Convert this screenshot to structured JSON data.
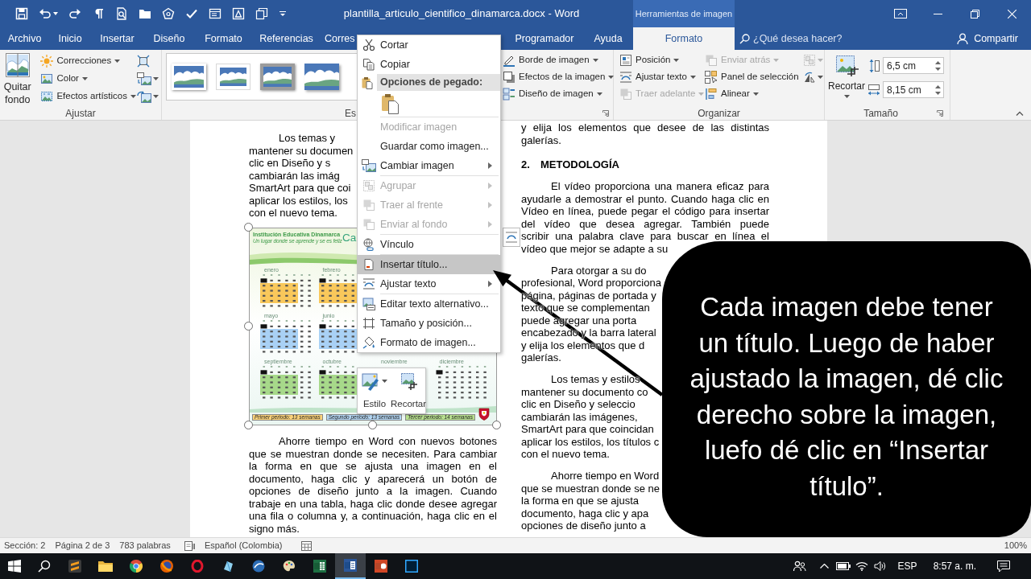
{
  "title_bar": {
    "title": "plantilla_articulo_cientifico_dinamarca.docx - Word",
    "contextual_header": "Herramientas de imagen"
  },
  "tabs": [
    {
      "label": "Archivo",
      "selected": false
    },
    {
      "label": "Inicio",
      "selected": false
    },
    {
      "label": "Insertar",
      "selected": false
    },
    {
      "label": "Diseño",
      "selected": false
    },
    {
      "label": "Formato",
      "selected": false
    },
    {
      "label": "Referencias",
      "selected": false
    },
    {
      "label": "Corres",
      "selected": false
    },
    {
      "label": "Programador",
      "selected": false
    },
    {
      "label": "Ayuda",
      "selected": false
    },
    {
      "label": "Formato",
      "selected": true
    }
  ],
  "search": {
    "placeholder": "¿Qué desea hacer?"
  },
  "share": {
    "label": "Compartir"
  },
  "ribbon": {
    "adjust": {
      "label": "Ajustar",
      "remove_background": "Quitar fondo",
      "buttons": [
        {
          "label": "Correcciones",
          "dropdown": true
        },
        {
          "label": "Color",
          "dropdown": true
        },
        {
          "label": "Efectos artísticos",
          "dropdown": true
        }
      ],
      "icon_buttons": [
        {
          "dropdown": false
        },
        {
          "dropdown": true
        },
        {
          "dropdown": true
        }
      ]
    },
    "picture_styles": {
      "label": "Es",
      "buttons": [
        {
          "label": "Borde de imagen",
          "dropdown": true
        },
        {
          "label": "Efectos de la imagen",
          "dropdown": true
        },
        {
          "label": "Diseño de imagen",
          "dropdown": true
        }
      ]
    },
    "arrange": {
      "label": "Organizar",
      "buttons": [
        {
          "label": "Posición",
          "dropdown": true,
          "disabled": false
        },
        {
          "label": "Ajustar texto",
          "dropdown": true,
          "disabled": false
        },
        {
          "label": "Traer adelante",
          "dropdown": true,
          "disabled": true
        },
        {
          "label": "Enviar atrás",
          "dropdown": true,
          "disabled": true
        },
        {
          "label": "Panel de selección",
          "dropdown": false,
          "disabled": false
        },
        {
          "label": "Alinear",
          "dropdown": true,
          "disabled": false
        }
      ],
      "icon_buttons": [
        {
          "dropdown": true,
          "disabled": true
        },
        {
          "dropdown": true,
          "disabled": false
        }
      ]
    },
    "size": {
      "label": "Tamaño",
      "crop": "Recortar",
      "height": "6,5 cm",
      "width": "8,15 cm"
    }
  },
  "document": {
    "left_column": [
      {
        "kind": "partial",
        "lines": [
          "Los temas y",
          "mantener su documen",
          "clic en Diseño y s",
          "cambiarán las imág",
          "SmartArt para que coi",
          "aplicar los estilos, los",
          "con el nuevo tema."
        ]
      },
      {
        "kind": "figure",
        "selected": true,
        "title": "Institución Educativa Dinamarca",
        "subtitle": "Un lugar donde se aprende y se es feliz",
        "heading": "Ca",
        "month_rows": [
          [
            {
              "name": "enero",
              "color": "#f9c85b"
            },
            {
              "name": "febrero",
              "color": "#f9c85b"
            }
          ],
          [
            {
              "name": "mayo",
              "color": "#a9d1f5"
            },
            {
              "name": "junio",
              "color": "#a9d1f5"
            }
          ],
          [
            {
              "name": "septiembre",
              "color": "#a7d98a"
            },
            {
              "name": "octubre",
              "color": "#a7d98a"
            },
            {
              "name": "noviembre"
            },
            {
              "name": "diciembre"
            }
          ]
        ],
        "periods": [
          {
            "label": "Primer periodo: 13 semanas",
            "color": "#fbd27a"
          },
          {
            "label": "Segundo periodo: 13 semanas",
            "color": "#b3d5f2"
          },
          {
            "label": "Tercer periodo: 14 semanas",
            "color": "#b8e08f"
          }
        ]
      },
      {
        "kind": "paragraph",
        "lines": [
          "Ahorre tiempo en Word con nuevos botones",
          "que se muestran donde se necesiten. Para cambiar",
          "la forma en que se ajusta una imagen en el",
          "documento, haga clic y aparecerá un botón de",
          "opciones de diseño junto a la imagen. Cuando",
          "trabaje en una tabla, haga clic donde desee agregar",
          "una fila o columna y, a continuación, haga clic en el",
          "signo más."
        ]
      }
    ],
    "right_column": [
      {
        "kind": "continuation",
        "lines": [
          "y elija los elementos que desee de las distintas",
          "galerías."
        ]
      },
      {
        "kind": "heading",
        "number": "2.",
        "text": "METODOLOGÍA"
      },
      {
        "kind": "paragraph",
        "lines": [
          "El vídeo proporciona una manera eficaz para",
          "ayudarle a demostrar el punto. Cuando haga clic en",
          "Vídeo en línea, puede pegar el código para insertar",
          "del vídeo que desea agregar. También puede",
          "scribir una palabra clave para buscar en línea el",
          "vídeo que mejor se adapte a su"
        ]
      },
      {
        "kind": "partial",
        "lines": [
          "Para otorgar a su do",
          "profesional, Word proporciona",
          "página, páginas de portada y",
          "texto que se complementan",
          "puede agregar una porta",
          "encabezado y la barra lateral",
          "y elija los elementos que d",
          "galerías."
        ]
      },
      {
        "kind": "partial",
        "lines": [
          "Los temas y estilos",
          "mantener su documento co",
          "clic en Diseño y seleccio",
          "cambiarán las imágenes,",
          "SmartArt para que coincidan",
          "aplicar los estilos, los títulos c",
          "con el nuevo tema."
        ]
      },
      {
        "kind": "partial",
        "lines": [
          "Ahorre tiempo en Word",
          "que se muestran donde se ne",
          "la forma en que se ajusta",
          "documento, haga clic y apa",
          "opciones de diseño junto a"
        ]
      }
    ]
  },
  "context_menu": {
    "items": [
      {
        "kind": "item",
        "label": "Cortar",
        "disabled": false,
        "submenu": false,
        "selected": false
      },
      {
        "kind": "item",
        "label": "Copiar",
        "disabled": false,
        "submenu": false,
        "selected": false
      },
      {
        "kind": "header",
        "label": "Opciones de pegado:"
      },
      {
        "kind": "paste_options"
      },
      {
        "kind": "separator"
      },
      {
        "kind": "item",
        "label": "Modificar imagen",
        "disabled": true,
        "submenu": false,
        "selected": false
      },
      {
        "kind": "item",
        "label": "Guardar como imagen...",
        "disabled": false,
        "submenu": false,
        "selected": false
      },
      {
        "kind": "item",
        "label": "Cambiar imagen",
        "disabled": false,
        "submenu": true,
        "selected": false
      },
      {
        "kind": "separator"
      },
      {
        "kind": "item",
        "label": "Agrupar",
        "disabled": true,
        "submenu": true,
        "selected": false
      },
      {
        "kind": "item",
        "label": "Traer al frente",
        "disabled": true,
        "submenu": true,
        "selected": false
      },
      {
        "kind": "item",
        "label": "Enviar al fondo",
        "disabled": true,
        "submenu": true,
        "selected": false
      },
      {
        "kind": "separator"
      },
      {
        "kind": "item",
        "label": "Vínculo",
        "disabled": false,
        "submenu": false,
        "selected": false
      },
      {
        "kind": "separator"
      },
      {
        "kind": "item",
        "label": "Insertar título...",
        "disabled": false,
        "submenu": false,
        "selected": true
      },
      {
        "kind": "item",
        "label": "Ajustar texto",
        "disabled": false,
        "submenu": true,
        "selected": false
      },
      {
        "kind": "separator"
      },
      {
        "kind": "item",
        "label": "Editar texto alternativo...",
        "disabled": false,
        "submenu": false,
        "selected": false
      },
      {
        "kind": "item",
        "label": "Tamaño y posición...",
        "disabled": false,
        "submenu": false,
        "selected": false
      },
      {
        "kind": "item",
        "label": "Formato de imagen...",
        "disabled": false,
        "submenu": false,
        "selected": false
      }
    ]
  },
  "mini_toolbar": {
    "buttons": [
      {
        "label": "Estilo",
        "dropdown": true
      },
      {
        "label": "Recortar",
        "dropdown": false
      }
    ]
  },
  "callout": {
    "text": "Cada imagen debe tener un título. Luego de haber ajustado la imagen, dé clic derecho sobre la imagen, luefo dé clic en “Insertar título”."
  },
  "status_bar": {
    "items": [
      "Sección: 2",
      "Página 2 de 3",
      "783 palabras"
    ],
    "language": "Español (Colombia)",
    "zoom": "100%"
  },
  "taskbar": {
    "apps": [
      {
        "selected": false
      },
      {
        "selected": false
      },
      {
        "selected": false
      },
      {
        "selected": false
      },
      {
        "selected": false
      },
      {
        "selected": false
      },
      {
        "selected": false
      },
      {
        "selected": false
      },
      {
        "selected": false
      },
      {
        "selected": true
      },
      {
        "selected": false
      },
      {
        "selected": false
      }
    ],
    "language": "ESP",
    "time": "8:57 a. m."
  }
}
